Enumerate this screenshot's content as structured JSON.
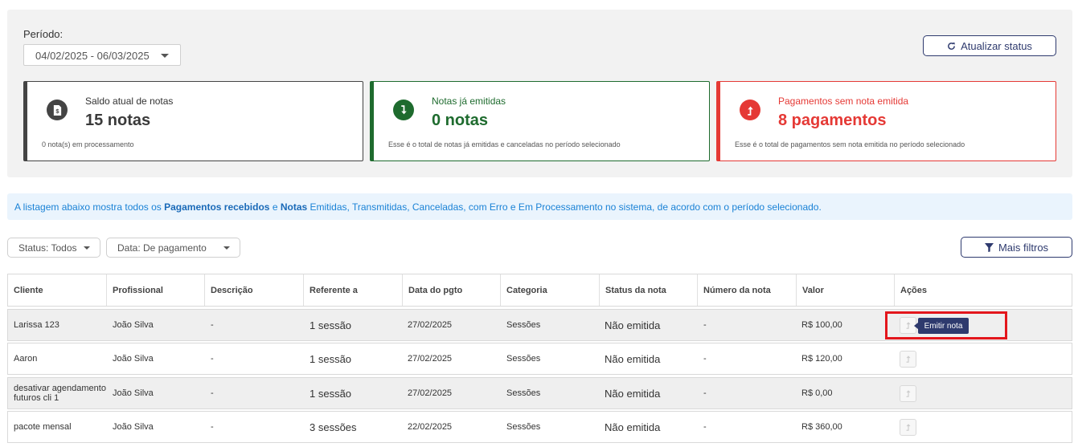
{
  "period": {
    "label": "Período:",
    "value": "04/02/2025 - 06/03/2025"
  },
  "refresh_button": {
    "label": "Atualizar status",
    "icon": "refresh-icon"
  },
  "cards": [
    {
      "title": "Saldo atual de notas",
      "value": "15 notas",
      "note": "0 nota(s) em processamento",
      "icon": "document-dollar-icon",
      "color": "#444444"
    },
    {
      "title": "Notas já emitidas",
      "value": "0 notas",
      "note": "Esse é o total de notas já emitidas e canceladas no período selecionado",
      "icon": "arrow-down-icon",
      "color": "#1e6b2e"
    },
    {
      "title": "Pagamentos sem nota emitida",
      "value": "8 pagamentos",
      "note": "Esse é o total de pagamentos sem nota emitida no período selecionado",
      "icon": "arrow-up-icon",
      "color": "#e53935"
    }
  ],
  "info": {
    "part1": "A listagem abaixo mostra todos os ",
    "bold1": "Pagamentos recebidos",
    "part2": " e ",
    "bold2": "Notas",
    "part3": " Emitidas, Transmitidas, Canceladas, com Erro e Em Processamento no sistema, de acordo com o período selecionado."
  },
  "filters": {
    "status": "Status: Todos",
    "date": "Data: De pagamento",
    "more": "Mais filtros"
  },
  "table": {
    "headers": [
      "Cliente",
      "Profissional",
      "Descrição",
      "Referente a",
      "Data do pgto",
      "Categoria",
      "Status da nota",
      "Número da nota",
      "Valor",
      "Ações"
    ],
    "rows": [
      {
        "cliente": "Larissa 123",
        "profissional": "João Silva",
        "descricao": "-",
        "referente": "1 sessão",
        "data": "27/02/2025",
        "categoria": "Sessões",
        "status": "Não emitida",
        "numero": "-",
        "valor": "R$ 100,00"
      },
      {
        "cliente": "Aaron",
        "profissional": "João Silva",
        "descricao": "-",
        "referente": "1 sessão",
        "data": "27/02/2025",
        "categoria": "Sessões",
        "status": "Não emitida",
        "numero": "-",
        "valor": "R$ 120,00"
      },
      {
        "cliente": "desativar agendamento futuros cli 1",
        "profissional": "João Silva",
        "descricao": "-",
        "referente": "1 sessão",
        "data": "27/02/2025",
        "categoria": "Sessões",
        "status": "Não emitida",
        "numero": "-",
        "valor": "R$ 0,00"
      },
      {
        "cliente": "pacote mensal",
        "profissional": "João Silva",
        "descricao": "-",
        "referente": "3 sessões",
        "data": "22/02/2025",
        "categoria": "Sessões",
        "status": "Não emitida",
        "numero": "-",
        "valor": "R$ 360,00"
      }
    ]
  },
  "tooltip": "Emitir nota"
}
